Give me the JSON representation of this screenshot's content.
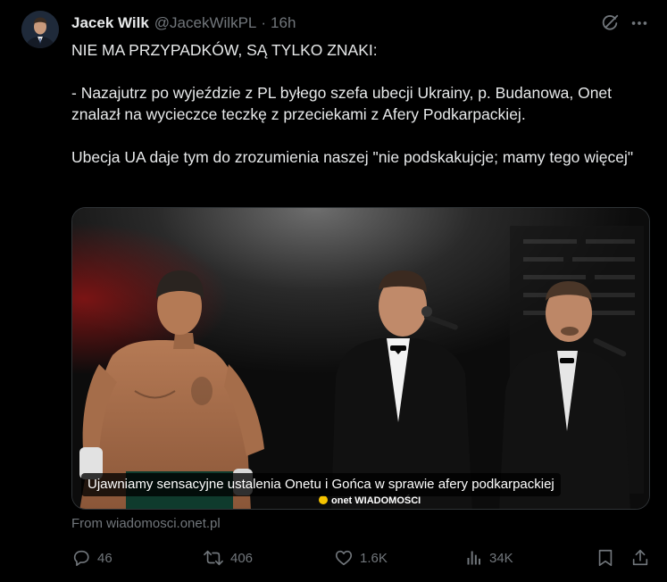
{
  "author": {
    "name": "Jacek Wilk",
    "handle": "@JacekWilkPL",
    "separator": "·",
    "time": "16h"
  },
  "tweet": {
    "line1": "NIE MA PRZYPADKÓW, SĄ TYLKO ZNAKI:",
    "para2": "- Nazajutrz po wyjeździe z PL byłego szefa ubecji Ukrainy, p. Budanowa, Onet znalazł na wycieczce teczkę z przeciekami z Afery Podkarpackiej.",
    "para3": "Ubecja UA daje tym do zrozumienia naszej \"nie podskakujcje; mamy tego więcej\""
  },
  "media": {
    "caption": "Ujawniamy sensacyjne ustalenia Onetu i Gońca w sprawie afery podkarpackiej",
    "watermark": "onet WIADOMOŚCI"
  },
  "source": "From wiadomosci.onet.pl",
  "actions": {
    "replies": "46",
    "reposts": "406",
    "likes": "1.6K",
    "views": "34K"
  },
  "icons": {
    "reply": "reply-icon",
    "repost": "repost-icon",
    "like": "heart-icon",
    "views": "views-icon",
    "bookmark": "bookmark-icon",
    "share": "share-icon",
    "grok": "grok-icon",
    "more": "more-icon"
  },
  "colors": {
    "background": "#000000",
    "text": "#e7e9ea",
    "muted": "#71767b",
    "border": "#2f3336"
  }
}
